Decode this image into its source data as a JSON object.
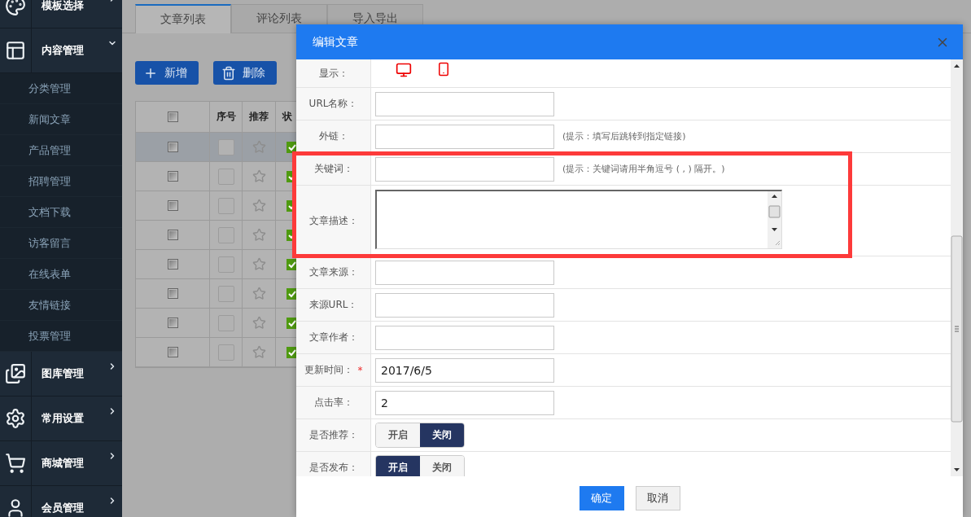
{
  "sidebar": {
    "items": [
      {
        "label": "模板选择",
        "expanded": false
      },
      {
        "label": "内容管理",
        "expanded": true,
        "children": [
          {
            "label": "分类管理"
          },
          {
            "label": "新闻文章"
          },
          {
            "label": "产品管理"
          },
          {
            "label": "招聘管理"
          },
          {
            "label": "文档下载"
          },
          {
            "label": "访客留言"
          },
          {
            "label": "在线表单"
          },
          {
            "label": "友情链接"
          },
          {
            "label": "投票管理"
          }
        ]
      },
      {
        "label": "图库管理",
        "expanded": false
      },
      {
        "label": "常用设置",
        "expanded": false
      },
      {
        "label": "商城管理",
        "expanded": false
      },
      {
        "label": "会员管理",
        "expanded": false
      }
    ]
  },
  "tabs": [
    {
      "label": "文章列表",
      "selected": true
    },
    {
      "label": "评论列表",
      "selected": false
    },
    {
      "label": "导入导出",
      "selected": false
    }
  ],
  "toolbar": {
    "buttons": [
      {
        "label": "新增",
        "kind": "add"
      },
      {
        "label": "删除",
        "kind": "delete"
      }
    ]
  },
  "table": {
    "select_all": {
      "checked": false
    },
    "columns": [
      "序号",
      "推荐",
      "状"
    ],
    "rows": [
      {
        "selected": true,
        "checked": false,
        "starred": false,
        "status_on": true
      },
      {
        "selected": false,
        "checked": false,
        "starred": false,
        "status_on": true
      },
      {
        "selected": false,
        "checked": false,
        "starred": false,
        "status_on": true
      },
      {
        "selected": false,
        "checked": false,
        "starred": false,
        "status_on": true
      },
      {
        "selected": false,
        "checked": false,
        "starred": false,
        "status_on": true
      },
      {
        "selected": false,
        "checked": false,
        "starred": false,
        "status_on": true
      },
      {
        "selected": false,
        "checked": false,
        "starred": false,
        "status_on": true
      },
      {
        "selected": false,
        "checked": false,
        "starred": false,
        "status_on": true
      }
    ]
  },
  "dialog": {
    "title": "编辑文章",
    "fields": [
      {
        "kind": "devices",
        "label": "显示："
      },
      {
        "kind": "input",
        "label": "URL名称："
      },
      {
        "kind": "input",
        "label": "外链：",
        "hint": "(提示：填写后跳转到指定链接)"
      },
      {
        "kind": "input",
        "label": "关键词：",
        "hint": "(提示：关键词请用半角逗号 ( , ) 隔开。)"
      },
      {
        "kind": "textarea",
        "label": "文章描述："
      },
      {
        "kind": "input",
        "label": "文章来源："
      },
      {
        "kind": "input",
        "label": "来源URL："
      },
      {
        "kind": "input",
        "label": "文章作者："
      },
      {
        "kind": "input",
        "label": "更新时间：",
        "required_mark": "*",
        "value": "2017/6/5"
      },
      {
        "kind": "input",
        "label": "点击率：",
        "value": "2"
      },
      {
        "kind": "toggle",
        "label": "是否推荐：",
        "options": [
          {
            "label": "开启",
            "selected": false
          },
          {
            "label": "关闭",
            "selected": true
          }
        ]
      },
      {
        "kind": "toggle",
        "label": "是否发布：",
        "options": [
          {
            "label": "开启",
            "selected": true
          },
          {
            "label": "关闭",
            "selected": false
          }
        ]
      }
    ],
    "buttons": [
      {
        "label": "确定",
        "kind": "primary"
      },
      {
        "label": "取消",
        "kind": "secondary"
      }
    ]
  }
}
